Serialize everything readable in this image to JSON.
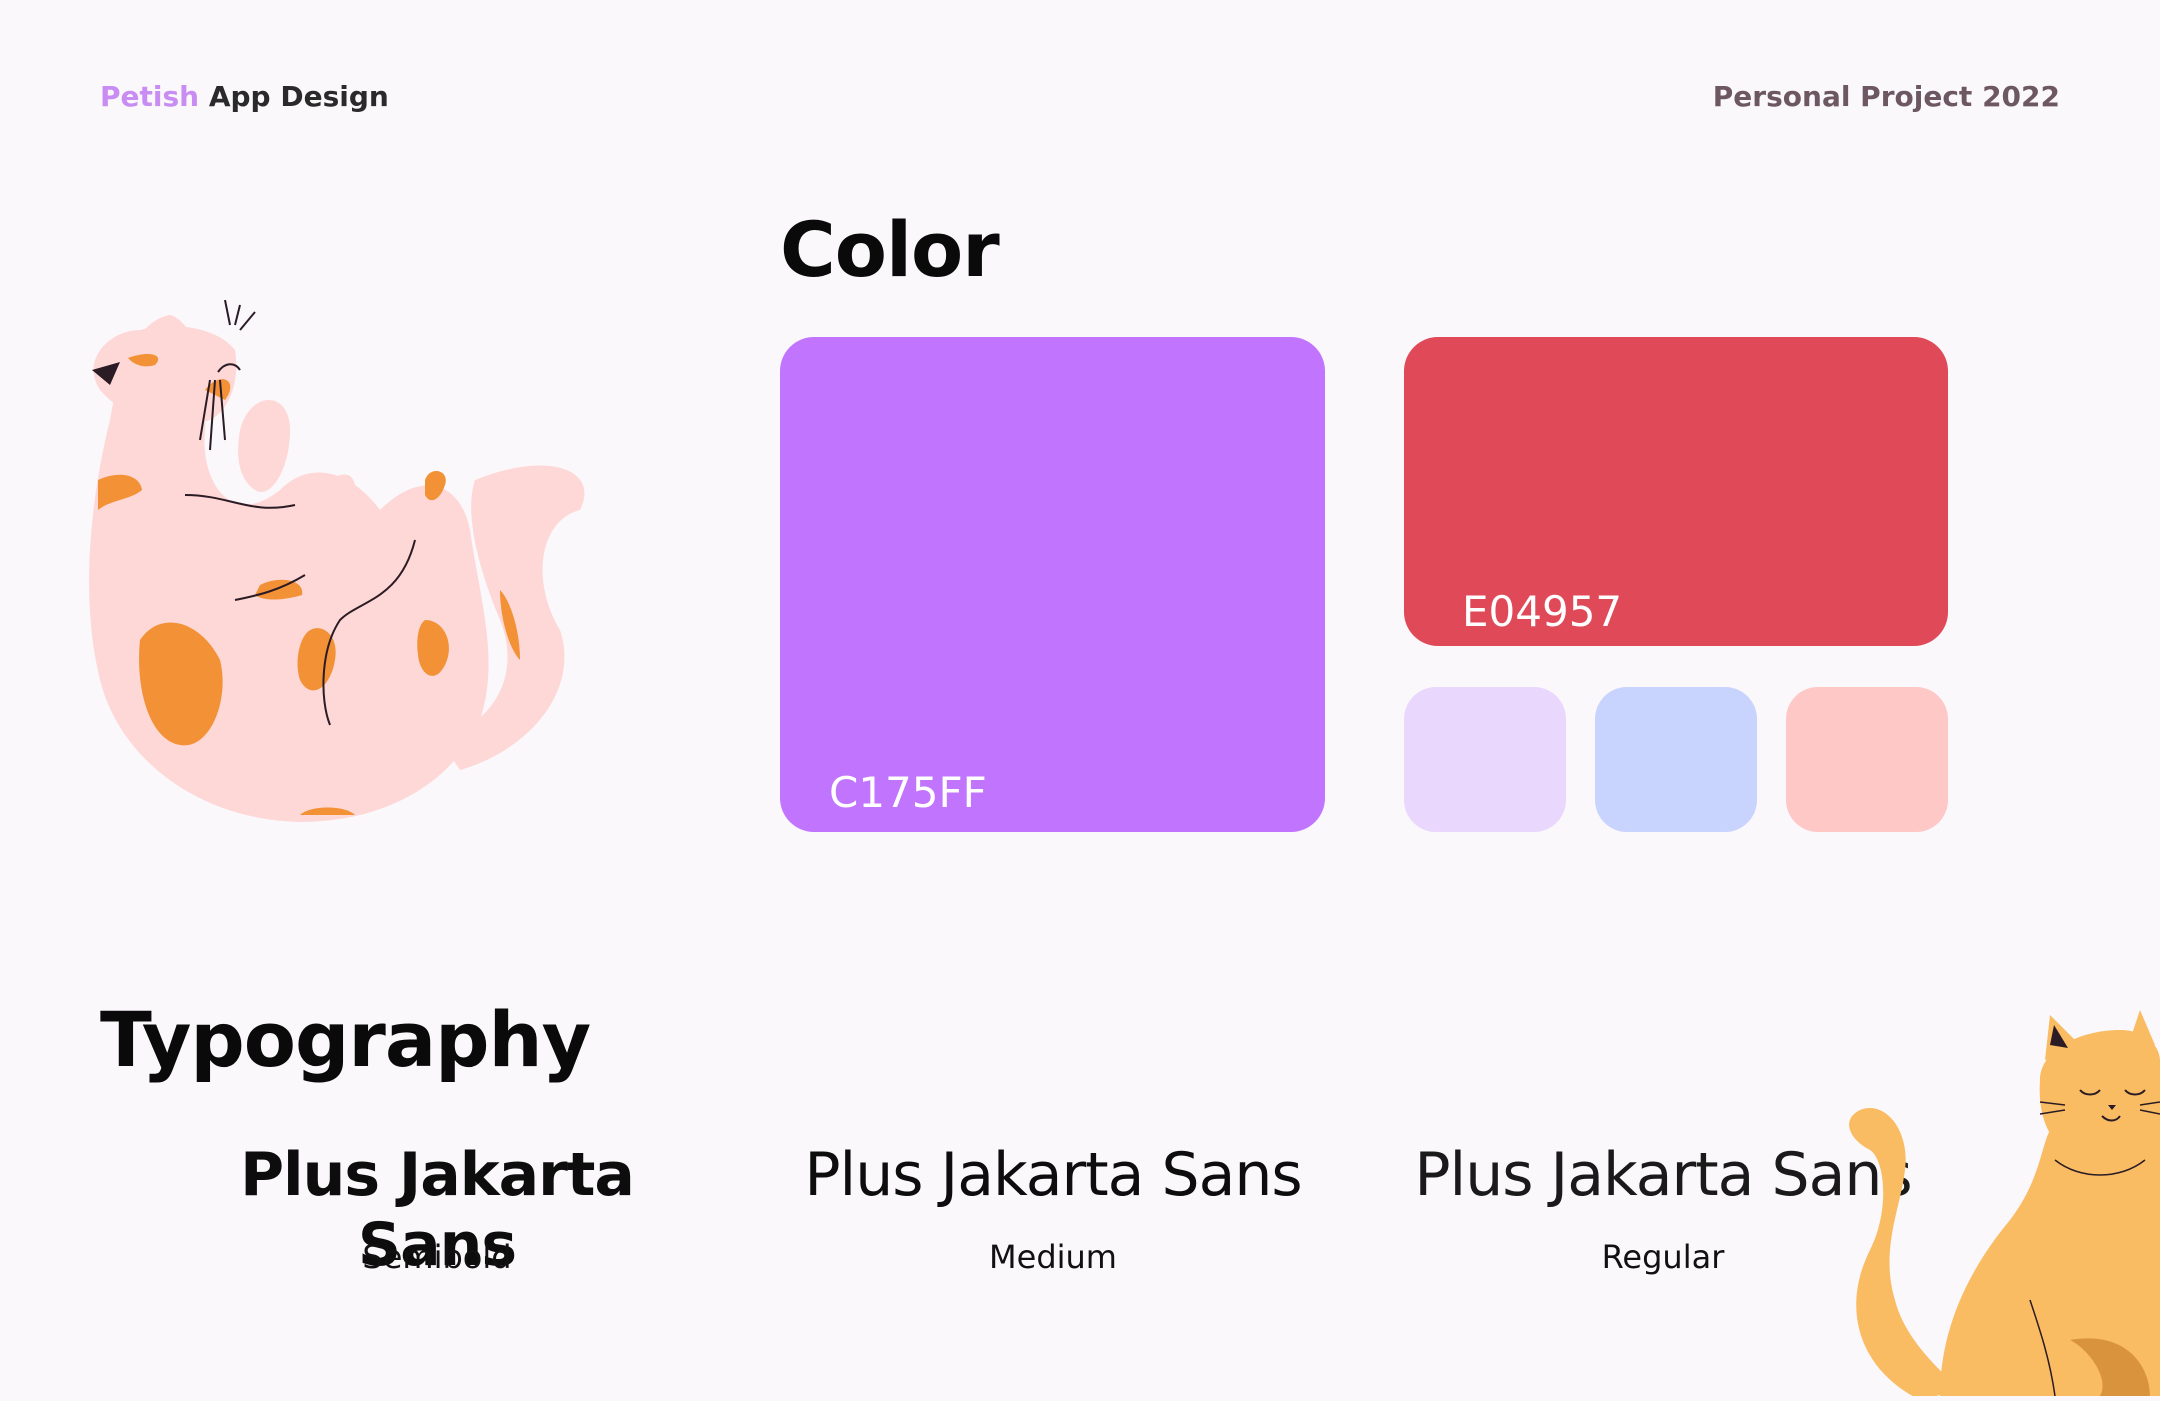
{
  "header": {
    "brand_accent": "Petish",
    "brand_rest": "App Design",
    "project": "Personal Project 2022"
  },
  "color_section": {
    "title": "Color",
    "primary": {
      "hex_label": "C175FF",
      "color": "#C175FF"
    },
    "secondary": {
      "hex_label": "E04957",
      "color": "#E04957"
    },
    "tints": [
      {
        "color": "#E9D7FD"
      },
      {
        "color": "#C8D4FD"
      },
      {
        "color": "#FEC8C6"
      }
    ]
  },
  "typography_section": {
    "title": "Typography",
    "samples": [
      {
        "font": "Plus Jakarta Sans",
        "weight": "Semibold"
      },
      {
        "font": "Plus Jakarta Sans",
        "weight": "Medium"
      },
      {
        "font": "Plus Jakarta Sans",
        "weight": "Regular"
      }
    ]
  },
  "illustrations": {
    "left": "sleeping-cat-illustration",
    "right": "sitting-cat-illustration"
  }
}
